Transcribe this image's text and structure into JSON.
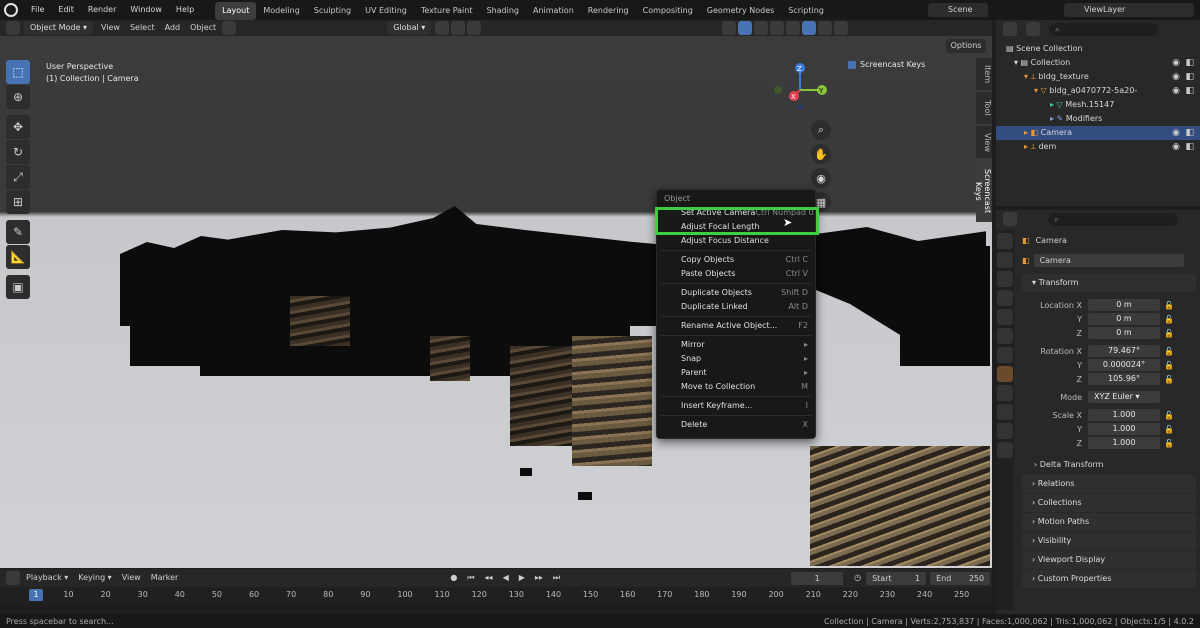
{
  "menu": [
    "File",
    "Edit",
    "Render",
    "Window",
    "Help"
  ],
  "workspaces": [
    "Layout",
    "Modeling",
    "Sculpting",
    "UV Editing",
    "Texture Paint",
    "Shading",
    "Animation",
    "Rendering",
    "Compositing",
    "Geometry Nodes",
    "Scripting"
  ],
  "scene": "Scene",
  "view_layer": "ViewLayer",
  "viewport_header": {
    "mode": "Object Mode",
    "items": [
      "View",
      "Select",
      "Add",
      "Object"
    ],
    "transform": "Global",
    "options": "Options"
  },
  "viewport": {
    "perspective": "User Perspective",
    "collection_info": "(1) Collection | Camera",
    "screencast_keys": "Screencast Keys",
    "gizmo": {
      "z": "Z",
      "y": "Y",
      "x": "X"
    }
  },
  "side_tabs": [
    "Item",
    "Tool",
    "View",
    "Screencast Keys"
  ],
  "context_menu": {
    "title": "Object",
    "items": [
      {
        "label": "Set Active Camera",
        "shortcut": "Ctrl Numpad 0"
      },
      {
        "label": "Adjust Focal Length",
        "shortcut": ""
      },
      {
        "label": "Adjust Focus Distance",
        "shortcut": ""
      },
      {
        "label": "Copy Objects",
        "shortcut": "Ctrl C"
      },
      {
        "label": "Paste Objects",
        "shortcut": "Ctrl V"
      },
      {
        "label": "Duplicate Objects",
        "shortcut": "Shift D"
      },
      {
        "label": "Duplicate Linked",
        "shortcut": "Alt D"
      },
      {
        "label": "Rename Active Object...",
        "shortcut": "F2"
      },
      {
        "label": "Mirror",
        "shortcut": "▸"
      },
      {
        "label": "Snap",
        "shortcut": "▸"
      },
      {
        "label": "Parent",
        "shortcut": "▸"
      },
      {
        "label": "Move to Collection",
        "shortcut": "M"
      },
      {
        "label": "Insert Keyframe...",
        "shortcut": "I"
      },
      {
        "label": "Delete",
        "shortcut": "X"
      }
    ]
  },
  "outliner": {
    "rows": [
      {
        "label": "Scene Collection",
        "indent": 0
      },
      {
        "label": "Collection",
        "indent": 1
      },
      {
        "label": "bldg_texture",
        "indent": 2
      },
      {
        "label": "bldg_a0470772-5a20-",
        "indent": 3
      },
      {
        "label": "Mesh.15147",
        "indent": 4
      },
      {
        "label": "Modifiers",
        "indent": 4
      },
      {
        "label": "Camera",
        "indent": 2
      },
      {
        "label": "dem",
        "indent": 2
      }
    ]
  },
  "properties": {
    "object_name": "Camera",
    "name_field": "Camera",
    "transform_label": "Transform",
    "location": {
      "label": "Location X",
      "x": "0 m",
      "y": "0 m",
      "z": "0 m"
    },
    "rotation": {
      "label": "Rotation X",
      "x": "79.467°",
      "y": "0.000024°",
      "z": "105.96°"
    },
    "mode_label": "Mode",
    "mode": "XYZ Euler",
    "scale": {
      "label": "Scale X",
      "x": "1.000",
      "y": "1.000",
      "z": "1.000"
    },
    "axis_y": "Y",
    "axis_z": "Z",
    "delta_transform": "Delta Transform",
    "panels": [
      "Relations",
      "Collections",
      "Motion Paths",
      "Visibility",
      "Viewport Display",
      "Custom Properties"
    ]
  },
  "timeline": {
    "items": [
      "Playback",
      "Keying",
      "View",
      "Marker"
    ],
    "current_frame": "1",
    "start_label": "Start",
    "start": "1",
    "end_label": "End",
    "end": "250",
    "playhead": "1",
    "ticks": [
      "10",
      "20",
      "30",
      "40",
      "50",
      "60",
      "70",
      "80",
      "90",
      "100",
      "110",
      "120",
      "130",
      "140",
      "150",
      "160",
      "170",
      "180",
      "190",
      "200",
      "210",
      "220",
      "230",
      "240",
      "250"
    ]
  },
  "status": {
    "hint": "Press spacebar to search...",
    "stats": "Collection | Camera | Verts:2,753,837 | Faces:1,000,062 | Tris:1,000,062 | Objects:1/5 | 4.0.2"
  }
}
